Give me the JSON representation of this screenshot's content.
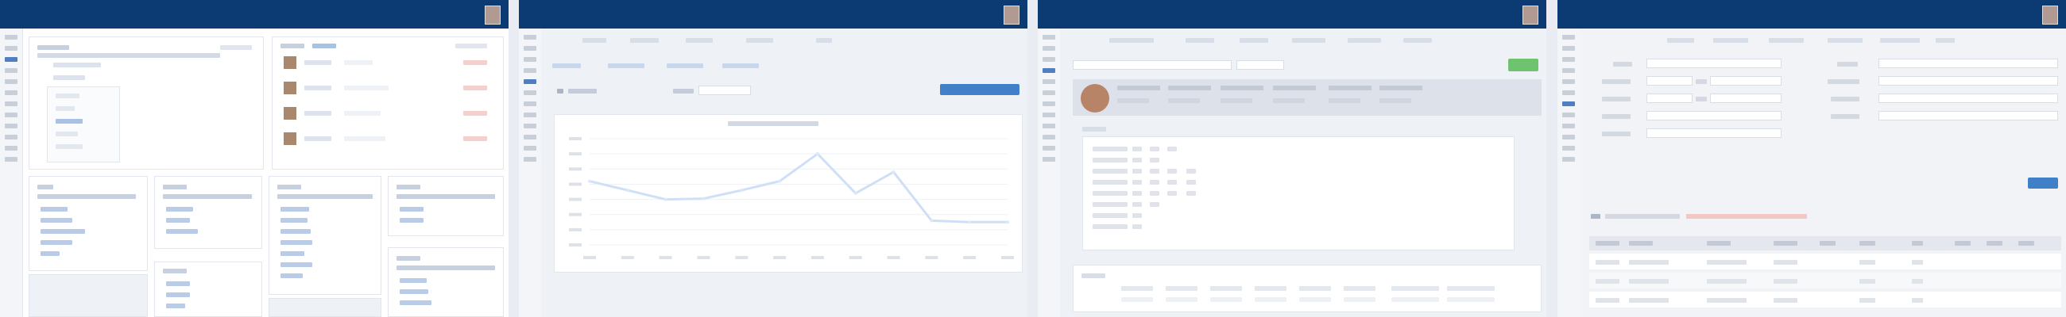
{
  "app": {
    "brand": "",
    "brand_sub": "",
    "user_name": ""
  },
  "panel1": {
    "sidebar_count": 14,
    "main_title": "",
    "list_items": [
      "",
      "",
      "",
      "",
      ""
    ],
    "right_people": [
      {
        "name": "",
        "detail": "",
        "status": ""
      },
      {
        "name": "",
        "detail": "",
        "status": ""
      },
      {
        "name": "",
        "detail": "",
        "status": ""
      },
      {
        "name": "",
        "detail": "",
        "status": ""
      }
    ],
    "cards": [
      {
        "title": "",
        "links": [
          "",
          "",
          "",
          "",
          ""
        ]
      },
      {
        "title": "",
        "links": [
          "",
          "",
          "",
          ""
        ]
      },
      {
        "title": "",
        "links": [
          "",
          "",
          "",
          "",
          "",
          ""
        ]
      },
      {
        "title": "",
        "links": [
          "",
          "",
          ""
        ]
      }
    ]
  },
  "panel2": {
    "tabs": [
      "",
      "",
      "",
      "",
      "",
      "",
      ""
    ],
    "filter_label": "",
    "filter_value": "",
    "action_label": "",
    "chart_title": ""
  },
  "chart_data": {
    "type": "line",
    "title": "",
    "x": [
      1,
      2,
      3,
      4,
      5,
      6,
      7,
      8,
      9,
      10,
      11,
      12
    ],
    "series": [
      {
        "values": [
          420,
          360,
          300,
          305,
          360,
          420,
          600,
          340,
          480,
          160,
          150,
          150
        ]
      }
    ],
    "ylim": [
      0,
      700
    ],
    "grid": true,
    "legend": "none"
  },
  "panel3": {
    "tabs": [
      "",
      "",
      "",
      "",
      "",
      "",
      ""
    ],
    "search_placeholder": "",
    "add_label": "",
    "header_fields": [
      "",
      "",
      "",
      "",
      "",
      ""
    ],
    "detail_rows": [
      [
        "",
        "",
        "",
        ""
      ],
      [
        "",
        "",
        "",
        ""
      ],
      [
        "",
        "",
        "",
        ""
      ],
      [
        "",
        "",
        "",
        ""
      ],
      [
        "",
        "",
        "",
        ""
      ],
      [
        "",
        "",
        "",
        ""
      ],
      [
        "",
        "",
        "",
        ""
      ],
      [
        "",
        "",
        "",
        ""
      ]
    ],
    "footer_labels": [
      "",
      "",
      "",
      "",
      "",
      "",
      "",
      ""
    ]
  },
  "panel4": {
    "tabs": [
      "",
      "",
      "",
      "",
      "",
      "",
      ""
    ],
    "form_left": [
      {
        "label": "",
        "value": ""
      },
      {
        "label": "",
        "value": ""
      },
      {
        "label": "",
        "value": ""
      },
      {
        "label": "",
        "value": ""
      },
      {
        "label": "",
        "value": ""
      }
    ],
    "form_right": [
      {
        "label": "",
        "value": ""
      },
      {
        "label": "",
        "value": ""
      },
      {
        "label": "",
        "value": ""
      },
      {
        "label": "",
        "value": ""
      }
    ],
    "save_label": "",
    "table_title": "",
    "table_alert": "",
    "table_headers": [
      "",
      "",
      "",
      "",
      "",
      "",
      "",
      "",
      "",
      ""
    ],
    "table_rows": [
      [
        "",
        "",
        "",
        "",
        "",
        ""
      ],
      [
        "",
        "",
        "",
        "",
        "",
        ""
      ],
      [
        "",
        "",
        "",
        "",
        "",
        ""
      ]
    ]
  }
}
